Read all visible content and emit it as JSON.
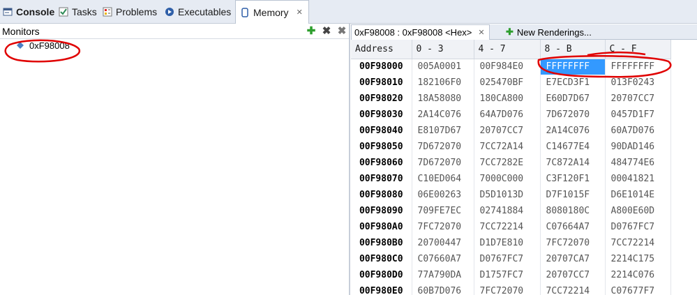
{
  "tabs": [
    {
      "label": "Console",
      "icon": "console-icon"
    },
    {
      "label": "Tasks",
      "icon": "tasks-icon"
    },
    {
      "label": "Problems",
      "icon": "problems-icon"
    },
    {
      "label": "Executables",
      "icon": "executables-icon"
    },
    {
      "label": "Memory",
      "icon": "memory-icon"
    }
  ],
  "monitors": {
    "title": "Monitors",
    "item": "0xF98008",
    "tools": [
      "add-monitor-icon",
      "remove-monitor-icon",
      "remove-all-icon"
    ]
  },
  "renderings": {
    "active_tab": "0xF98008 : 0xF98008 <Hex>",
    "new_tab": "New Renderings..."
  },
  "memory_table": {
    "headers": [
      "Address",
      "0 - 3",
      "4 - 7",
      "8 - B",
      "C - F"
    ],
    "rows": [
      [
        "00F98000",
        "005A0001",
        "00F984E0",
        "FFFFFFFF",
        "FFFFFFFF"
      ],
      [
        "00F98010",
        "182106F0",
        "025470BF",
        "E7ECD3F1",
        "013F0243"
      ],
      [
        "00F98020",
        "18A58080",
        "180CA800",
        "E60D7D67",
        "20707CC7"
      ],
      [
        "00F98030",
        "2A14C076",
        "64A7D076",
        "7D672070",
        "0457D1F7"
      ],
      [
        "00F98040",
        "E8107D67",
        "20707CC7",
        "2A14C076",
        "60A7D076"
      ],
      [
        "00F98050",
        "7D672070",
        "7CC72A14",
        "C14677E4",
        "90DAD146"
      ],
      [
        "00F98060",
        "7D672070",
        "7CC7282E",
        "7C872A14",
        "484774E6"
      ],
      [
        "00F98070",
        "C10ED064",
        "7000C000",
        "C3F120F1",
        "00041821"
      ],
      [
        "00F98080",
        "06E00263",
        "D5D1013D",
        "D7F1015F",
        "D6E1014E"
      ],
      [
        "00F98090",
        "709FE7EC",
        "02741884",
        "8080180C",
        "A800E60D"
      ],
      [
        "00F980A0",
        "7FC72070",
        "7CC72214",
        "C07664A7",
        "D0767FC7"
      ],
      [
        "00F980B0",
        "20700447",
        "D1D7E810",
        "7FC72070",
        "7CC72214"
      ],
      [
        "00F980C0",
        "C07660A7",
        "D0767FC7",
        "20707CA7",
        "2214C175"
      ],
      [
        "00F980D0",
        "77A790DA",
        "D1757FC7",
        "20707CC7",
        "2214C076"
      ],
      [
        "00F980E0",
        "60B7D076",
        "7FC72070",
        "7CC72214",
        "C07677F7"
      ]
    ],
    "selected_cell": {
      "row": 0,
      "col": 3
    }
  },
  "colors": {
    "selection": "#3399ff",
    "annotation": "#e00000",
    "add_icon": "#2e9e2e"
  }
}
